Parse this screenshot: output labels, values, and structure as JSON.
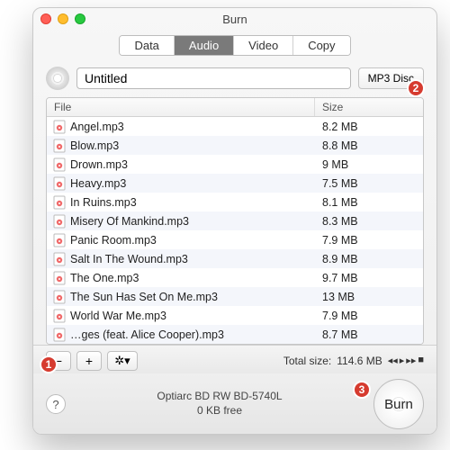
{
  "window": {
    "title": "Burn"
  },
  "tabs": {
    "items": [
      "Data",
      "Audio",
      "Video",
      "Copy"
    ],
    "activeIndex": 1
  },
  "disc": {
    "name": "Untitled",
    "type_label": "MP3 Disc"
  },
  "columns": {
    "file": "File",
    "size": "Size"
  },
  "files": [
    {
      "name": "Angel.mp3",
      "size": "8.2 MB"
    },
    {
      "name": "Blow.mp3",
      "size": "8.8 MB"
    },
    {
      "name": "Drown.mp3",
      "size": "9 MB"
    },
    {
      "name": "Heavy.mp3",
      "size": "7.5 MB"
    },
    {
      "name": "In Ruins.mp3",
      "size": "8.1 MB"
    },
    {
      "name": "Misery Of Mankind.mp3",
      "size": "8.3 MB"
    },
    {
      "name": "Panic Room.mp3",
      "size": "7.9 MB"
    },
    {
      "name": "Salt In The Wound.mp3",
      "size": "8.9 MB"
    },
    {
      "name": "The One.mp3",
      "size": "9.7 MB"
    },
    {
      "name": "The Sun Has Set On Me.mp3",
      "size": "13 MB"
    },
    {
      "name": "World War Me.mp3",
      "size": "7.9 MB"
    },
    {
      "name": "…ges (feat. Alice Cooper).mp3",
      "size": "8.7 MB"
    }
  ],
  "toolbar": {
    "remove_glyph": "−",
    "add_glyph": "+",
    "gear_glyph": "✲▾",
    "total_label": "Total size:",
    "total_value": "114.6 MB",
    "transport": {
      "prev": "◂◂",
      "play": "▸",
      "next": "▸▸",
      "stop": "■"
    }
  },
  "bottom": {
    "help_glyph": "?",
    "drive_name": "Optiarc BD RW BD-5740L",
    "free": "0 KB free",
    "burn_label": "Burn"
  },
  "badges": {
    "one": "1",
    "two": "2",
    "three": "3"
  }
}
